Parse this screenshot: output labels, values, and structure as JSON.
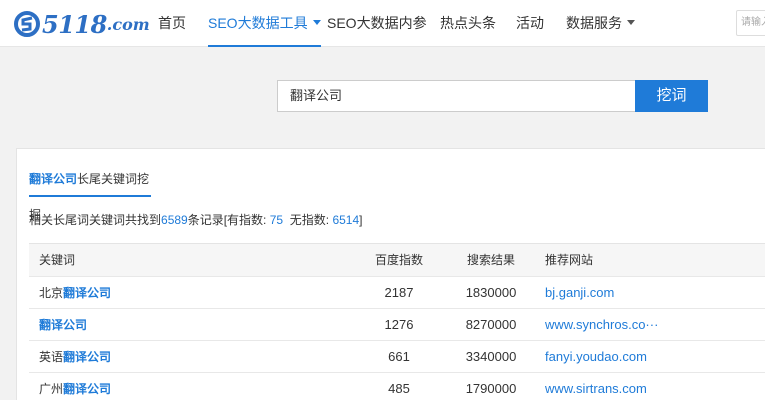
{
  "header": {
    "logo_text": "5118",
    "logo_domain": ".com",
    "login_placeholder": "请输入",
    "nav": [
      {
        "label": "首页",
        "active": false,
        "dropdown": false
      },
      {
        "label": "SEO大数据工具",
        "active": true,
        "dropdown": true
      },
      {
        "label": "SEO大数据内参",
        "active": false,
        "dropdown": false
      },
      {
        "label": "热点头条",
        "active": false,
        "dropdown": false
      },
      {
        "label": "活动",
        "active": false,
        "dropdown": false
      },
      {
        "label": "数据服务",
        "active": false,
        "dropdown": true
      }
    ]
  },
  "search": {
    "value": "翻译公司",
    "button_label": "挖词"
  },
  "panel": {
    "tab_highlight": "翻译公司",
    "tab_rest": "长尾关键词挖掘",
    "summary": {
      "prefix": "相关长尾词关键词共找到",
      "total": "6589",
      "mid": "条记录[有指数:",
      "with_index": "75",
      "mid2": "无指数:",
      "without_index": "6514",
      "suffix": "]"
    },
    "table": {
      "headers": [
        "关键词",
        "百度指数",
        "搜索结果",
        "推荐网站"
      ],
      "rows": [
        {
          "prefix": "北京",
          "keyword": "翻译公司",
          "index": "2187",
          "results": "1830000",
          "site": "bj.ganji.com"
        },
        {
          "prefix": "",
          "keyword": "翻译公司",
          "index": "1276",
          "results": "8270000",
          "site": "www.synchros.co···"
        },
        {
          "prefix": "英语",
          "keyword": "翻译公司",
          "index": "661",
          "results": "3340000",
          "site": "fanyi.youdao.com"
        },
        {
          "prefix": "广州",
          "keyword": "翻译公司",
          "index": "485",
          "results": "1790000",
          "site": "www.sirtrans.com"
        }
      ]
    }
  },
  "colors": {
    "accent": "#1f7bd8",
    "logo": "#2d6fc4"
  }
}
